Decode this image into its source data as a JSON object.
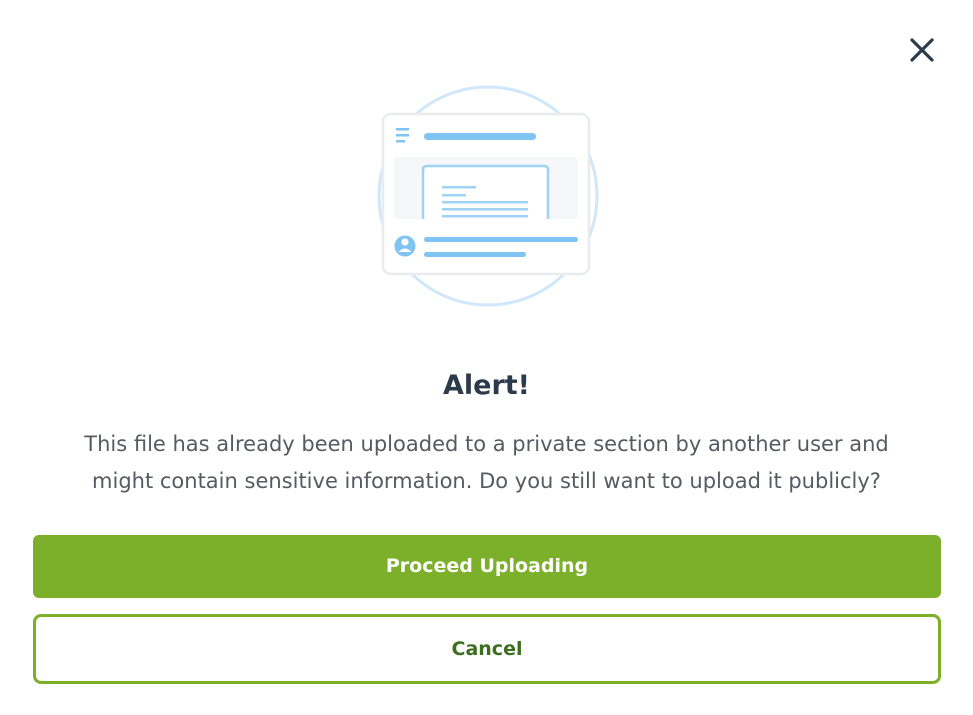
{
  "dialog": {
    "title": "Alert!",
    "message": "This file has already been uploaded to a private section by another user and might contain sensitive information. Do you still want to upload it publicly?",
    "primary_button": "Proceed Uploading",
    "secondary_button": "Cancel",
    "close_icon": "close-icon"
  },
  "colors": {
    "accent": "#7caf2a",
    "title": "#2b3b4a",
    "body_text": "#555b60",
    "illustration_blue": "#7fc4f2"
  }
}
